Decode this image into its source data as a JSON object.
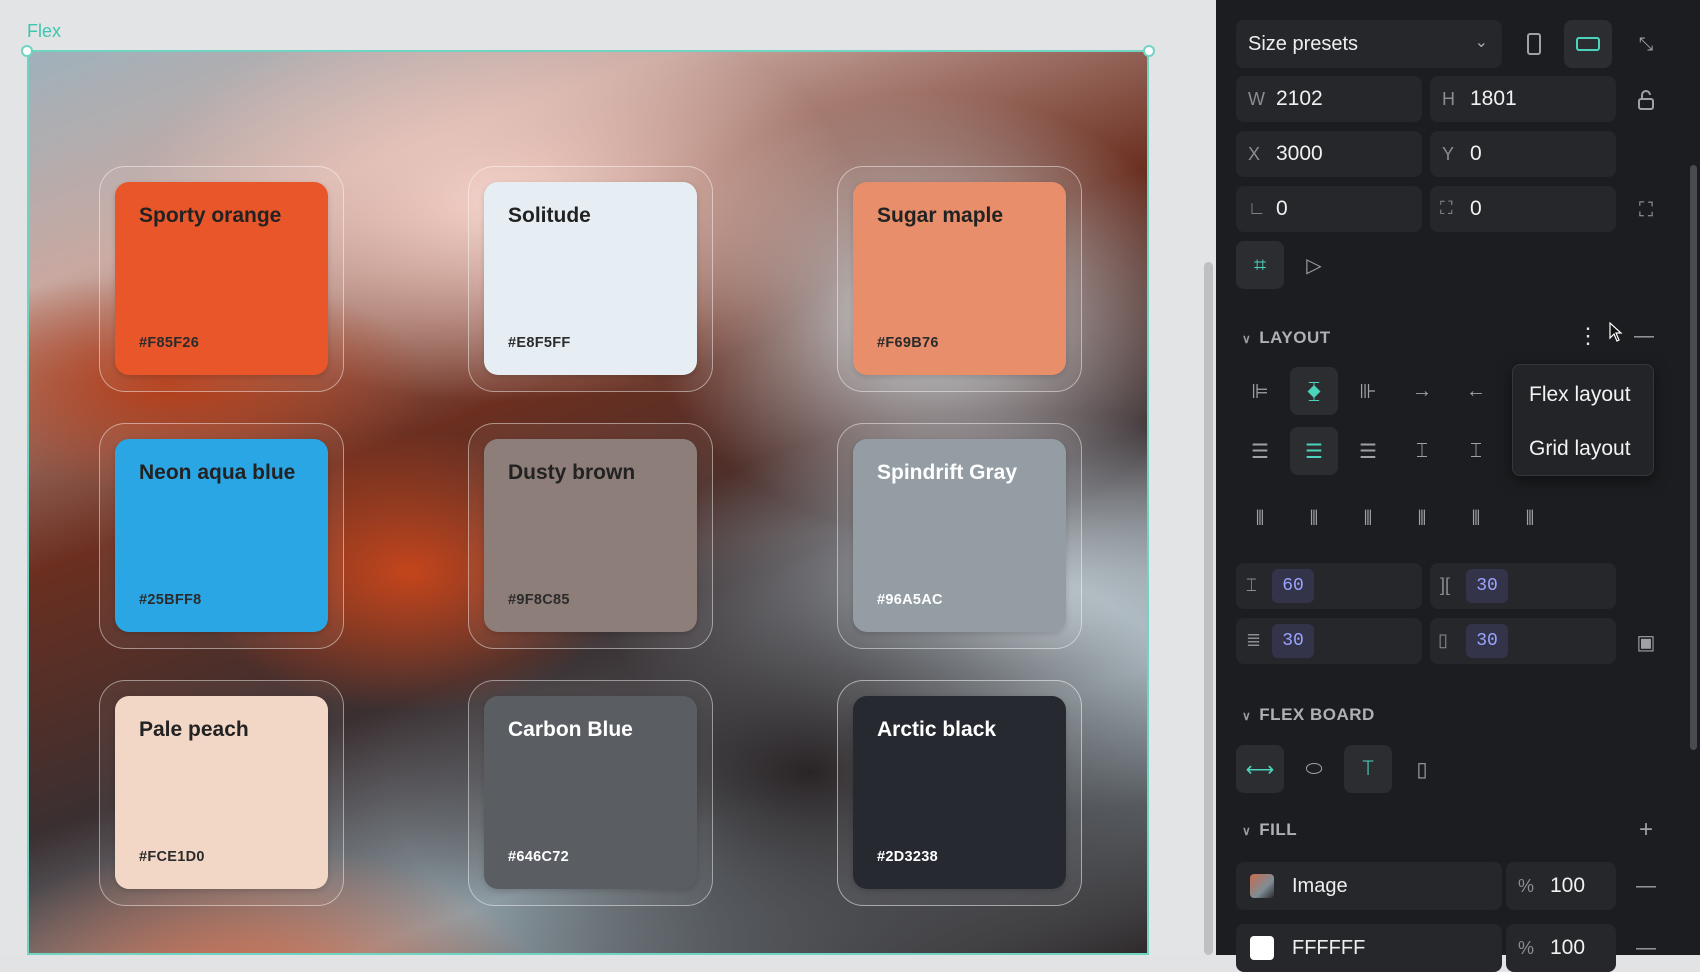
{
  "board": {
    "label": "Flex"
  },
  "cards": [
    {
      "name": "Sporty orange",
      "hex": "#F85F26",
      "color": "#E8562A"
    },
    {
      "name": "Solitude",
      "hex": "#E8F5FF",
      "color": "#E6EEF4"
    },
    {
      "name": "Sugar maple",
      "hex": "#F69B76",
      "color": "#E88E6A"
    },
    {
      "name": "Neon aqua blue",
      "hex": "#25BFF8",
      "color": "#2AA6E5"
    },
    {
      "name": "Dusty brown",
      "hex": "#9F8C85",
      "color": "#8E7E79"
    },
    {
      "name": "Spindrift Gray",
      "hex": "#96A5AC",
      "color": "#939DA3"
    },
    {
      "name": "Pale peach",
      "hex": "#FCE1D0",
      "color": "#F3D7C6"
    },
    {
      "name": "Carbon Blue",
      "hex": "#646C72",
      "color": "#5A5E62"
    },
    {
      "name": "Arctic black",
      "hex": "#2D3238",
      "color": "#262A30"
    }
  ],
  "panel": {
    "size_presets": "Size presets",
    "w_label": "W",
    "w_value": "2102",
    "h_label": "H",
    "h_value": "1801",
    "x_label": "X",
    "x_value": "3000",
    "y_label": "Y",
    "y_value": "0",
    "rotation_value": "0",
    "radius_value": "0",
    "layout_title": "LAYOUT",
    "menu_items": [
      "Flex layout",
      "Grid layout"
    ],
    "gap_row": "60",
    "gap_col": "30",
    "padding_v": "30",
    "padding_h": "30",
    "flex_board_title": "FLEX BOARD",
    "fill_title": "FILL",
    "fill_image_label": "Image",
    "fill_image_percent_sign": "%",
    "fill_image_opacity": "100",
    "fill_color_label": "FFFFFF",
    "fill_color_percent_sign": "%",
    "fill_color_opacity": "100"
  }
}
